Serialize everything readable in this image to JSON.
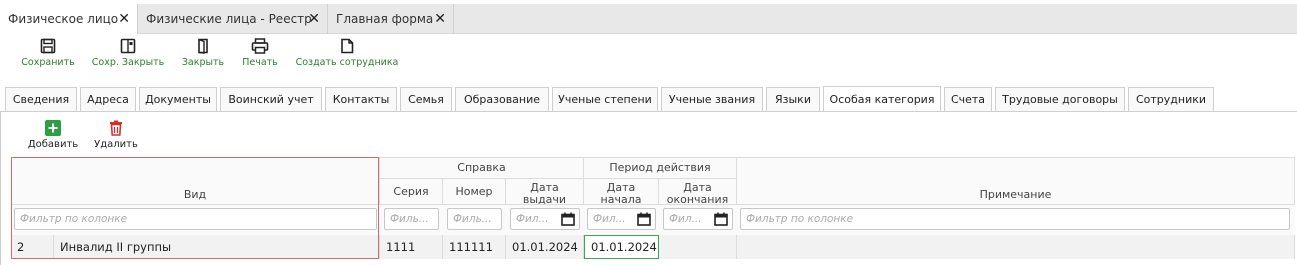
{
  "doc_tabs": [
    {
      "label": "Физическое лицо"
    },
    {
      "label": "Физические лица - Реестр"
    },
    {
      "label": "Главная форма"
    }
  ],
  "toolbar": {
    "save": "Сохранить",
    "save_close": "Сохр. Закрыть",
    "close": "Закрыть",
    "print": "Печать",
    "create_employee": "Создать сотрудника"
  },
  "section_tabs": [
    "Сведения",
    "Адреса",
    "Документы",
    "Воинский учет",
    "Контакты",
    "Семья",
    "Образование",
    "Ученые степени",
    "Ученые звания",
    "Языки",
    "Особая категория",
    "Счета",
    "Трудовые договоры",
    "Сотрудники"
  ],
  "active_section_tab": "Особая категория",
  "inner_toolbar": {
    "add": "Добавить",
    "delete": "Удалить"
  },
  "grid": {
    "headers": {
      "type": "Вид",
      "certificate_group": "Справка",
      "series": "Серия",
      "number": "Номер",
      "issue_date": "Дата выдачи",
      "period_group": "Период действия",
      "start_date": "Дата начала",
      "end_date": "Дата окончания",
      "note": "Примечание"
    },
    "filters": {
      "type": "Фильтр по колонке",
      "series": "Филь...",
      "number": "Филь...",
      "issue_date": "Фил...",
      "start_date": "Фил...",
      "end_date": "Фил...",
      "note": "Фильтр по колонке"
    },
    "rows": [
      {
        "code": "2",
        "type": "Инвалид II группы",
        "series": "1111",
        "number": "111111",
        "issue_date": "01.01.2024",
        "start_date": "01.01.2024",
        "end_date": "",
        "note": ""
      }
    ]
  },
  "colors": {
    "accent_green": "#2e7d32",
    "delete_red": "#d32f2f",
    "highlight_border": "#e06666",
    "selected_cell_border": "#3aa655"
  }
}
